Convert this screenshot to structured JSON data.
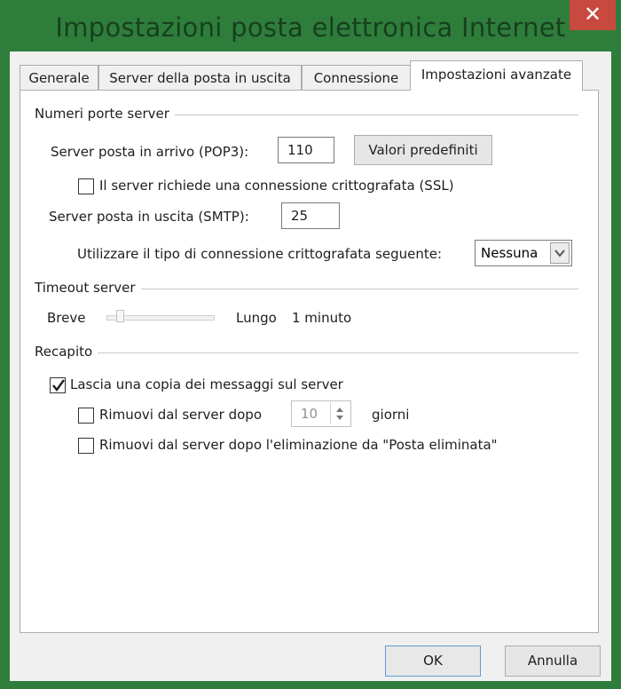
{
  "window": {
    "title": "Impostazioni posta elettronica Internet",
    "close_glyph": "✕"
  },
  "tabs": [
    {
      "label": "Generale",
      "active": false
    },
    {
      "label": "Server della posta in uscita",
      "active": false
    },
    {
      "label": "Connessione",
      "active": false
    },
    {
      "label": "Impostazioni avanzate",
      "active": true
    }
  ],
  "ports": {
    "group_label": "Numeri porte server",
    "pop3_label": "Server posta in arrivo (POP3):",
    "pop3_value": "110",
    "defaults_button": "Valori predefiniti",
    "ssl_label": "Il server richiede una connessione crittografata (SSL)",
    "ssl_checked": false,
    "smtp_label": "Server posta in uscita (SMTP):",
    "smtp_value": "25",
    "encryption_label": "Utilizzare il tipo di connessione crittografata seguente:",
    "encryption_value": "Nessuna"
  },
  "timeout": {
    "group_label": "Timeout server",
    "short_label": "Breve",
    "long_label": "Lungo",
    "value_label": "1 minuto",
    "level": 0.1
  },
  "delivery": {
    "group_label": "Recapito",
    "keep_copy_label": "Lascia una copia dei messaggi sul server",
    "keep_copy_checked": true,
    "remove_after_label": "Rimuovi dal server dopo",
    "remove_after_checked": false,
    "remove_after_days": "10",
    "days_label": "giorni",
    "remove_deleted_label": "Rimuovi dal server dopo l'eliminazione da \"Posta eliminata\"",
    "remove_deleted_checked": false
  },
  "buttons": {
    "ok": "OK",
    "cancel": "Annulla"
  },
  "colors": {
    "titlebar": "#2f7d3b",
    "close": "#c84a3e",
    "checkmark": "#1e1e1e"
  }
}
